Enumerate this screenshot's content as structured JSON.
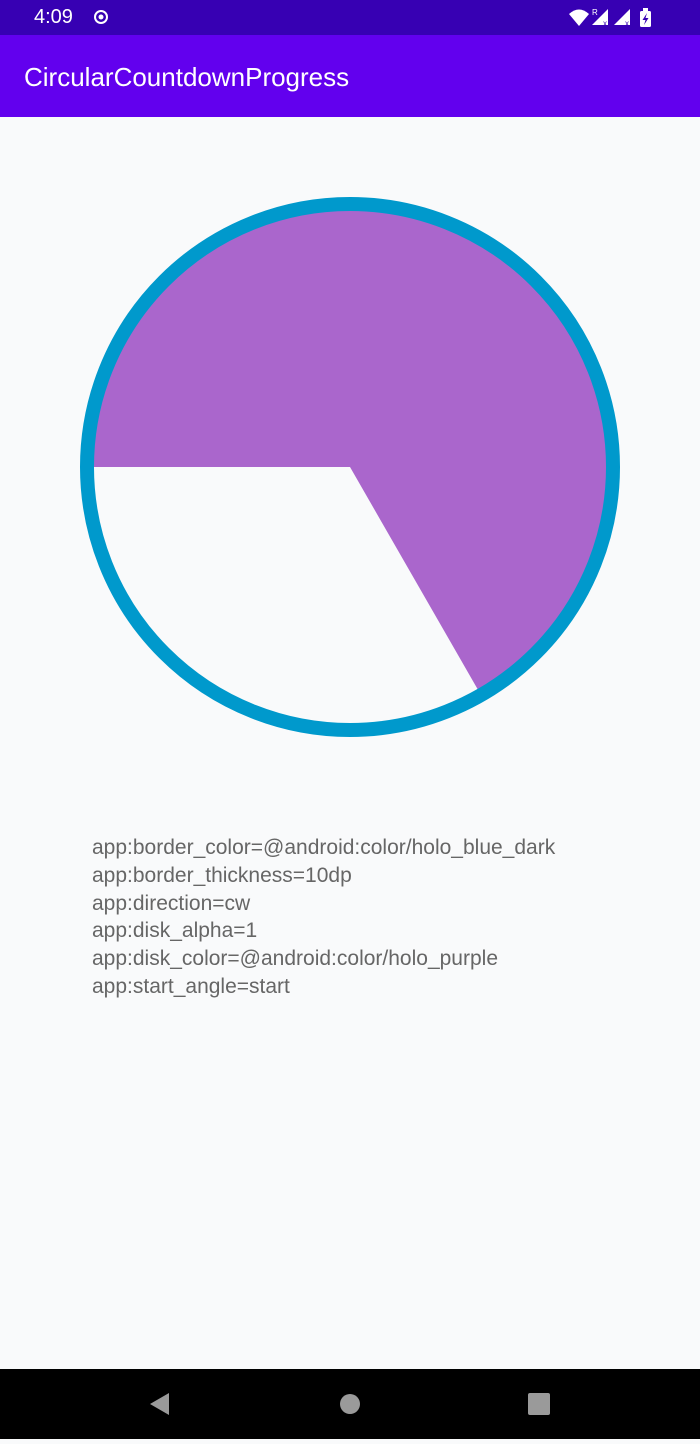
{
  "status_bar": {
    "time": "4:09",
    "icons": [
      "sync-icon",
      "wifi-icon",
      "signal-icon",
      "signal-icon",
      "battery-icon"
    ]
  },
  "app_bar": {
    "title": "CircularCountdownProgress"
  },
  "progress": {
    "fraction": 0.667,
    "start": "start",
    "direction": "cw",
    "border_color": "#0099cc",
    "disk_color": "#aa66cc"
  },
  "config": {
    "lines": [
      "app:border_color=@android:color/holo_blue_dark",
      "app:border_thickness=10dp",
      "app:direction=cw",
      "app:disk_alpha=1",
      "app:disk_color=@android:color/holo_purple",
      "app:start_angle=start"
    ]
  },
  "nav_bar": {
    "buttons": [
      "back-icon",
      "home-icon",
      "recents-icon"
    ]
  }
}
